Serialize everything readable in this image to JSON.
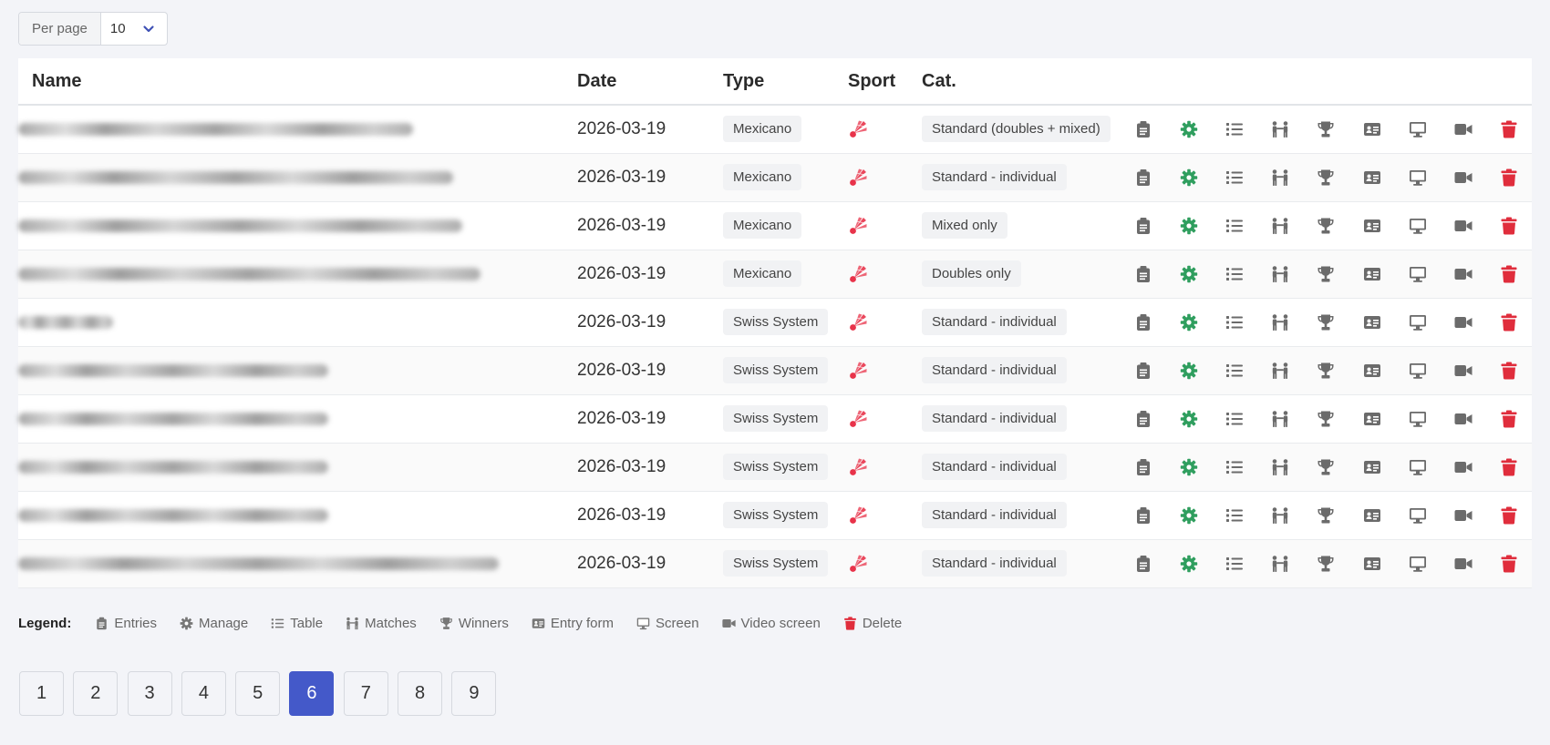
{
  "per_page": {
    "label": "Per page",
    "value": "10"
  },
  "table": {
    "headers": {
      "name": "Name",
      "date": "Date",
      "type": "Type",
      "sport": "Sport",
      "category": "Cat."
    },
    "rows": [
      {
        "date": "2026-03-19",
        "type": "Mexicano",
        "category": "Standard (doubles + mixed)"
      },
      {
        "date": "2026-03-19",
        "type": "Mexicano",
        "category": "Standard - individual"
      },
      {
        "date": "2026-03-19",
        "type": "Mexicano",
        "category": "Mixed only"
      },
      {
        "date": "2026-03-19",
        "type": "Mexicano",
        "category": "Doubles only"
      },
      {
        "date": "2026-03-19",
        "type": "Swiss System",
        "category": "Standard - individual"
      },
      {
        "date": "2026-03-19",
        "type": "Swiss System",
        "category": "Standard - individual"
      },
      {
        "date": "2026-03-19",
        "type": "Swiss System",
        "category": "Standard - individual"
      },
      {
        "date": "2026-03-19",
        "type": "Swiss System",
        "category": "Standard - individual"
      },
      {
        "date": "2026-03-19",
        "type": "Swiss System",
        "category": "Standard - individual"
      },
      {
        "date": "2026-03-19",
        "type": "Swiss System",
        "category": "Standard - individual"
      }
    ]
  },
  "icons": {
    "sport": "shuttlecock-icon",
    "actions": [
      "clipboard-icon",
      "gear-icon",
      "list-icon",
      "people-icon",
      "trophy-icon",
      "id-card-icon",
      "desktop-icon",
      "video-icon",
      "trash-icon"
    ]
  },
  "legend": {
    "title": "Legend:",
    "items": [
      {
        "icon": "clipboard-icon",
        "label": "Entries"
      },
      {
        "icon": "gear-icon",
        "label": "Manage"
      },
      {
        "icon": "list-icon",
        "label": "Table"
      },
      {
        "icon": "people-icon",
        "label": "Matches"
      },
      {
        "icon": "trophy-icon",
        "label": "Winners"
      },
      {
        "icon": "id-card-icon",
        "label": "Entry form"
      },
      {
        "icon": "desktop-icon",
        "label": "Screen"
      },
      {
        "icon": "video-icon",
        "label": "Video screen"
      },
      {
        "icon": "trash-icon",
        "label": "Delete"
      }
    ]
  },
  "pagination": {
    "pages": [
      "1",
      "2",
      "3",
      "4",
      "5",
      "6",
      "7",
      "8",
      "9"
    ],
    "current": "6"
  },
  "colors": {
    "primary": "#4459c9",
    "manage_green": "#2f9e5e",
    "delete_red": "#e02d3c",
    "sport_red": "#e8334a",
    "icon_gray": "#6b6b6b"
  }
}
